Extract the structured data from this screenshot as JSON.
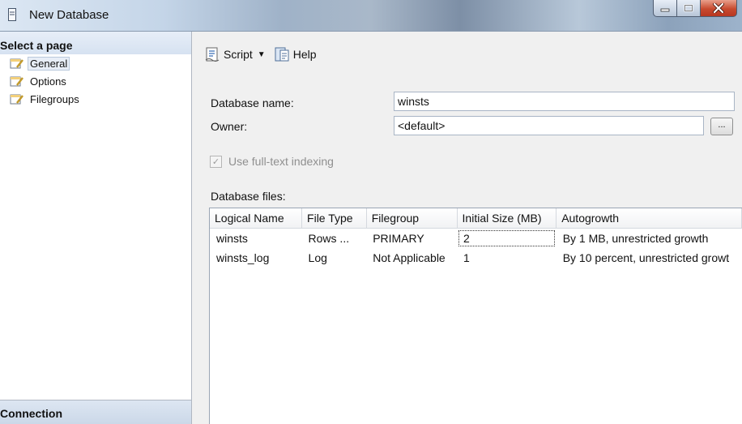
{
  "window": {
    "title": "New Database"
  },
  "left_panel": {
    "header": "Select a page",
    "pages": [
      {
        "label": "General",
        "selected": true
      },
      {
        "label": "Options",
        "selected": false
      },
      {
        "label": "Filegroups",
        "selected": false
      }
    ],
    "footer": "Connection"
  },
  "toolbar": {
    "script_label": "Script",
    "help_label": "Help"
  },
  "form": {
    "db_name_label": "Database name:",
    "db_name_value": "winsts",
    "owner_label": "Owner:",
    "owner_value": "<default>",
    "owner_browse_label": "...",
    "fulltext_label": "Use full-text indexing",
    "fulltext_checked": true,
    "files_label": "Database files:"
  },
  "files_table": {
    "columns": [
      "Logical Name",
      "File Type",
      "Filegroup",
      "Initial Size (MB)",
      "Autogrowth"
    ],
    "rows": [
      [
        "winsts",
        "Rows ...",
        "PRIMARY",
        "2",
        "By 1 MB, unrestricted growth"
      ],
      [
        "winsts_log",
        "Log",
        "Not Applicable",
        "1",
        "By 10 percent, unrestricted growt"
      ]
    ]
  },
  "icons": {
    "app": "document-icon",
    "page": "page-wrench-icon",
    "script": "script-icon",
    "help": "help-icon"
  },
  "colors": {
    "close_button": "#c74a2f",
    "panel_header": "#d6e2f1"
  }
}
